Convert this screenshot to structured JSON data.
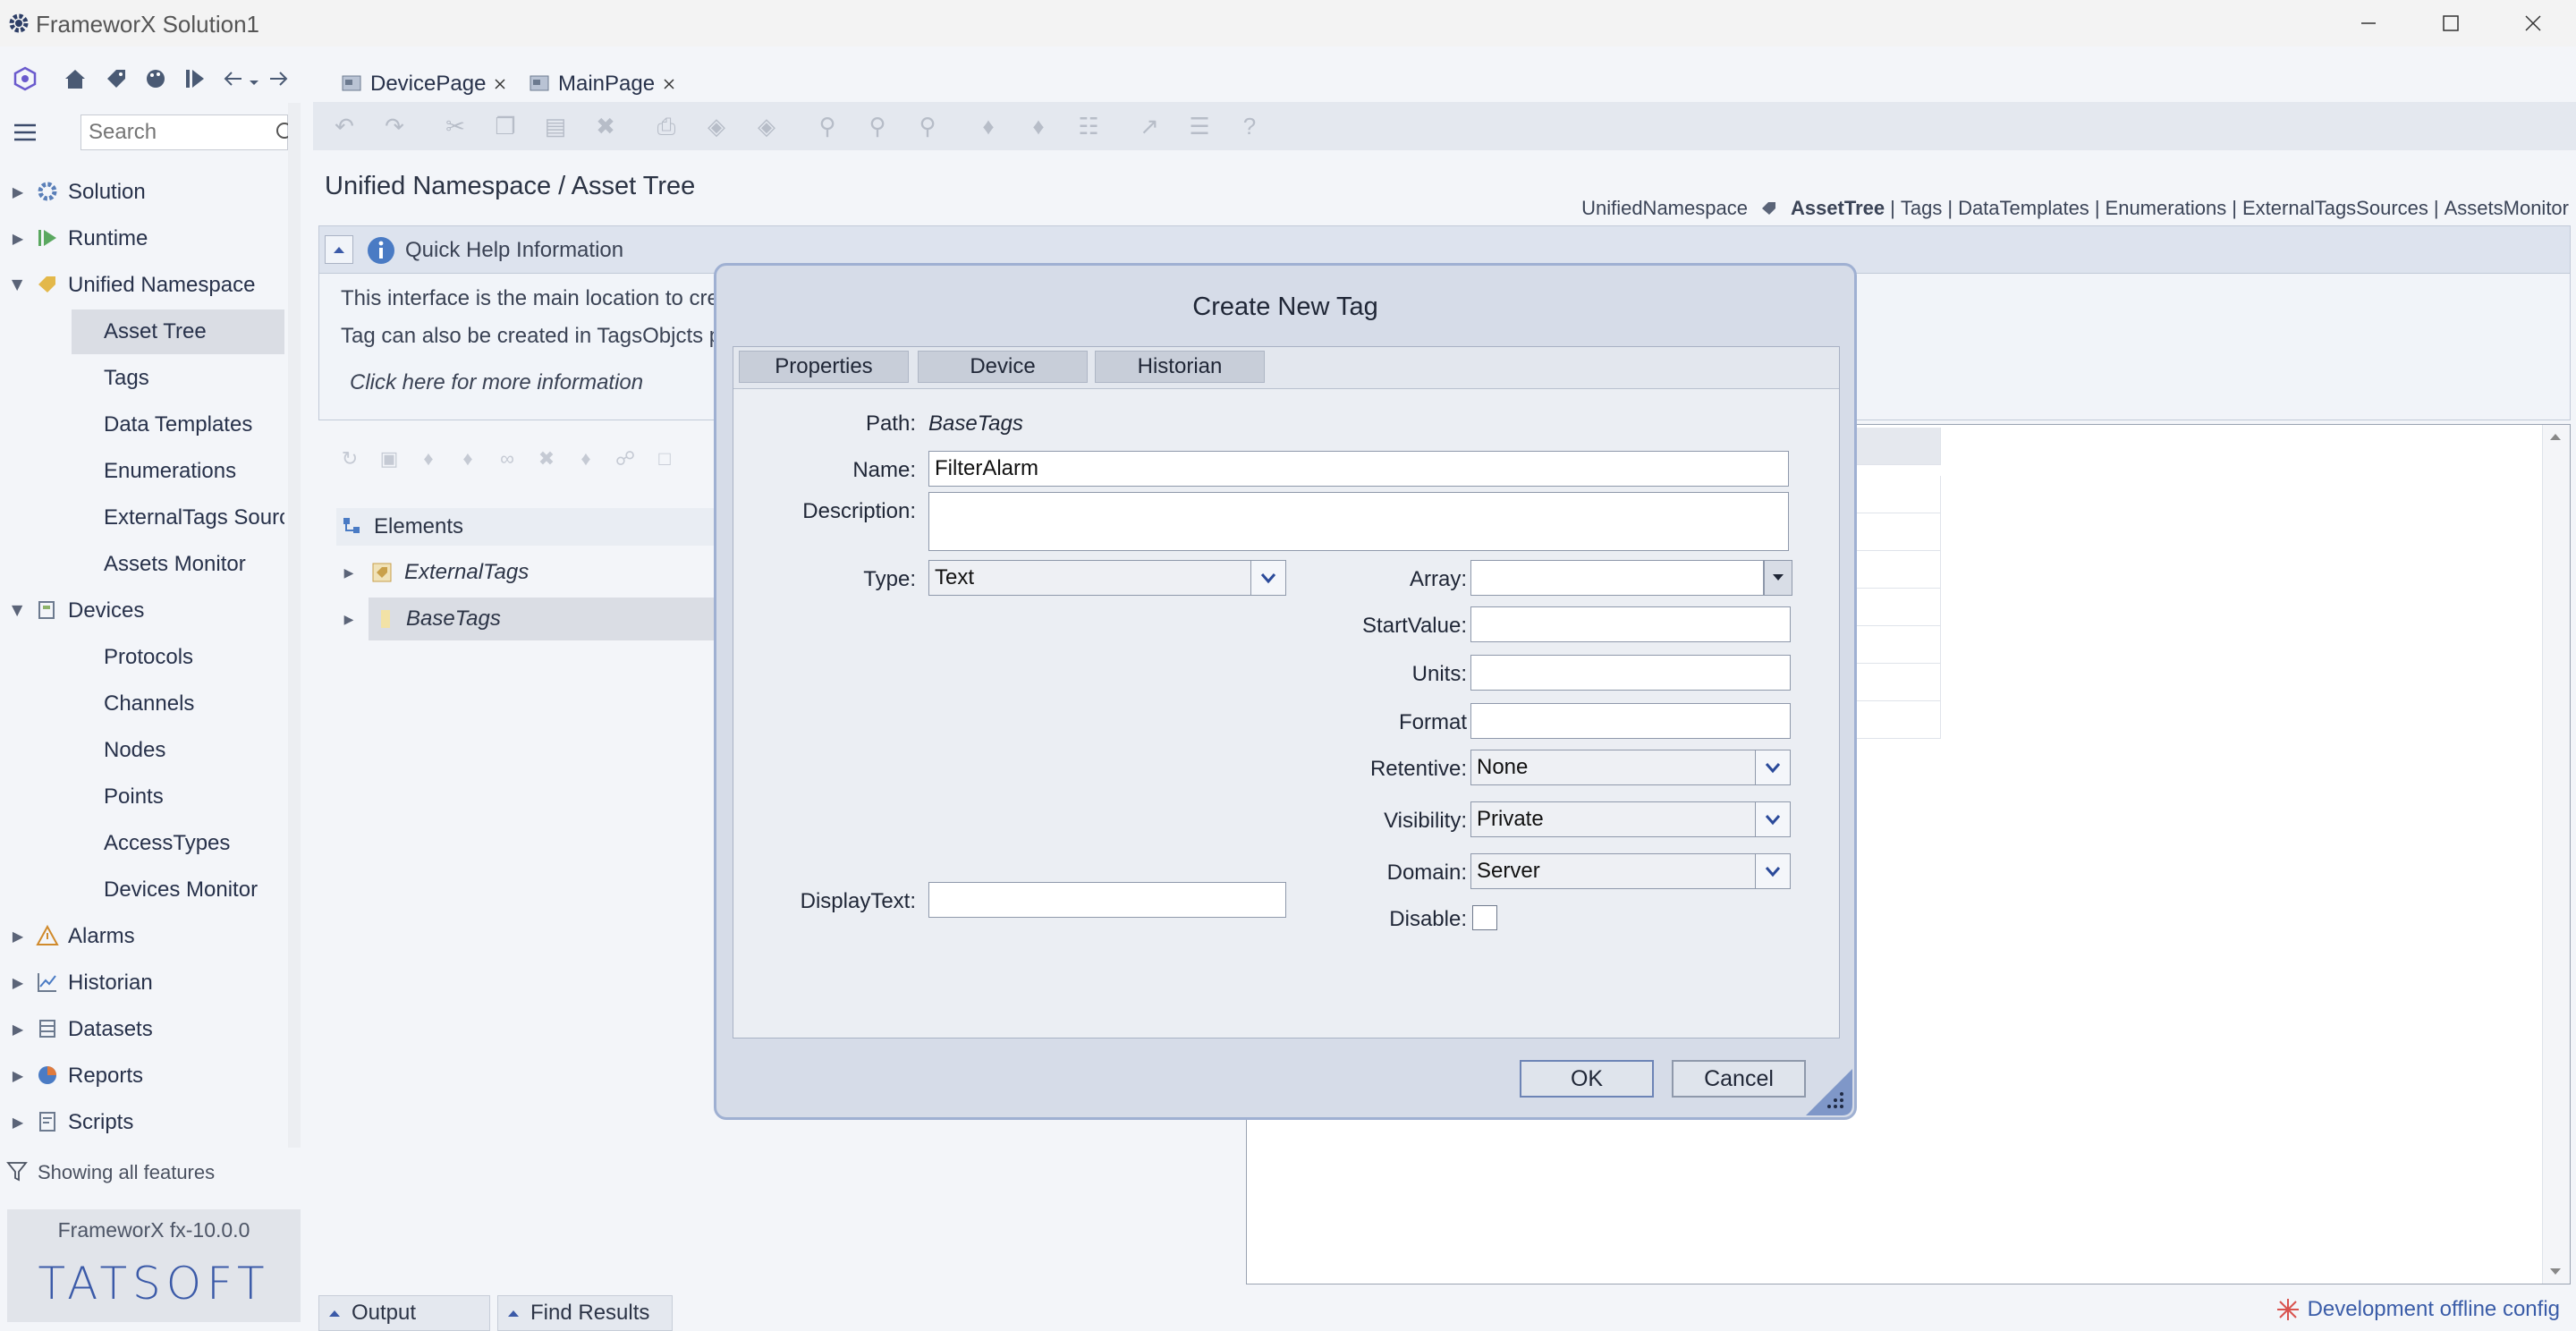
{
  "window": {
    "title": "FrameworX Solution1",
    "minimize_icon": "minimize-icon",
    "maximize_icon": "maximize-icon",
    "close_icon": "close-icon"
  },
  "doc_tabs": [
    {
      "label": "DevicePage"
    },
    {
      "label": "MainPage"
    }
  ],
  "search": {
    "placeholder": "Search"
  },
  "nav": {
    "items": [
      {
        "label": "Solution",
        "expanded": false
      },
      {
        "label": "Runtime",
        "expanded": false
      },
      {
        "label": "Unified Namespace",
        "expanded": true,
        "children": [
          "Asset Tree",
          "Tags",
          "Data Templates",
          "Enumerations",
          "ExternalTags Sources",
          "Assets Monitor"
        ]
      },
      {
        "label": "Devices",
        "expanded": true,
        "children": [
          "Protocols",
          "Channels",
          "Nodes",
          "Points",
          "AccessTypes",
          "Devices Monitor"
        ]
      },
      {
        "label": "Alarms",
        "expanded": false
      },
      {
        "label": "Historian",
        "expanded": false
      },
      {
        "label": "Datasets",
        "expanded": false
      },
      {
        "label": "Reports",
        "expanded": false
      },
      {
        "label": "Scripts",
        "expanded": false
      }
    ],
    "selected": "Asset Tree"
  },
  "filter_text": "Showing all features",
  "version": "FrameworX fx-10.0.0",
  "brand_logo": "TATSOFT",
  "page": {
    "title": "Unified Namespace / Asset Tree",
    "breadcrumb_root": "UnifiedNamespace",
    "breadcrumb_links": [
      "AssetTree",
      "Tags",
      "DataTemplates",
      "Enumerations",
      "ExternalTagsSources",
      "AssetsMonitor"
    ],
    "breadcrumb_current": "AssetTree"
  },
  "quick_help": {
    "title": "Quick Help Information",
    "line1": "This interface is the main location to cre",
    "line2": "Tag can also be created in TagsObjcts p",
    "link": "Click here for more information"
  },
  "elements": {
    "header": "Elements",
    "rows": [
      "ExternalTags",
      "BaseTags"
    ]
  },
  "bottom_tabs": [
    "Output",
    "Find Results"
  ],
  "status": {
    "text": "Development offline config"
  },
  "dialog": {
    "title": "Create New Tag",
    "tabs": [
      "Properties",
      "Device",
      "Historian"
    ],
    "path_label": "Path:",
    "path_value": "BaseTags",
    "name_label": "Name:",
    "name_value": "FilterAlarm",
    "description_label": "Description:",
    "description_value": "",
    "type_label": "Type:",
    "type_value": "Text",
    "array_label": "Array:",
    "array_value": "",
    "startvalue_label": "StartValue:",
    "startvalue_value": "",
    "units_label": "Units:",
    "units_value": "",
    "format_label": "Format",
    "format_value": "",
    "retentive_label": "Retentive:",
    "retentive_value": "None",
    "visibility_label": "Visibility:",
    "visibility_value": "Private",
    "domain_label": "Domain:",
    "domain_value": "Server",
    "displaytext_label": "DisplayText:",
    "displaytext_value": "",
    "disable_label": "Disable:",
    "disable_checked": false,
    "ok_label": "OK",
    "cancel_label": "Cancel"
  },
  "colors": {
    "accent": "#3b5aa8",
    "dialog_bg": "#d6dce8",
    "selected_row": "#dadde4"
  }
}
